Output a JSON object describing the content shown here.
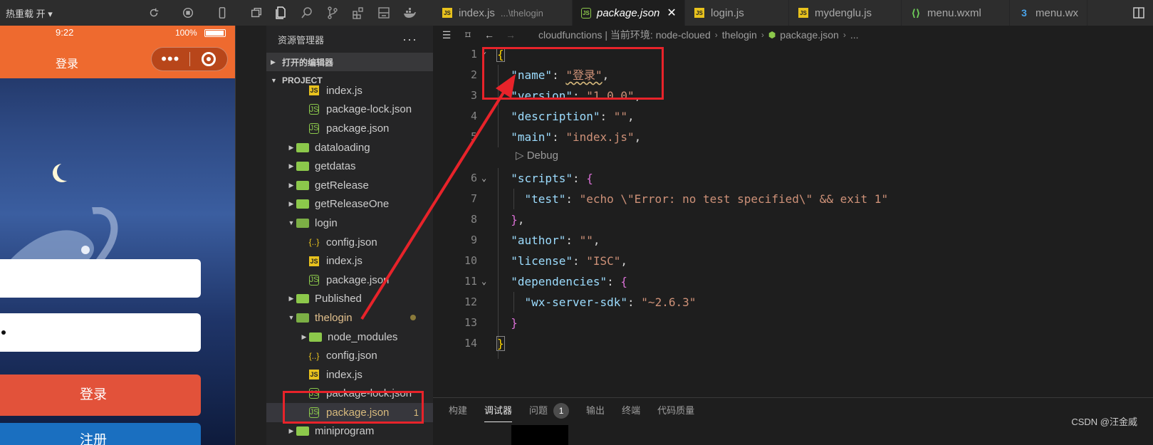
{
  "toolbar": {
    "hot_reload": "热重载 开 ▾"
  },
  "simulator": {
    "time": "9:22",
    "battery": "100%",
    "nav_title": "登录",
    "capsule_dots": "•••",
    "login_button": "登录",
    "register_button": "注册"
  },
  "explorer": {
    "title": "资源管理器",
    "more": "···",
    "open_editors": "打开的编辑器",
    "project": "PROJECT",
    "tree": [
      {
        "label": "index.js",
        "icon": "js",
        "depth": 2
      },
      {
        "label": "package-lock.json",
        "icon": "node",
        "depth": 2
      },
      {
        "label": "package.json",
        "icon": "node",
        "depth": 2
      },
      {
        "label": "dataloading",
        "icon": "folder",
        "depth": 1,
        "caret": "▶"
      },
      {
        "label": "getdatas",
        "icon": "folder",
        "depth": 1,
        "caret": "▶"
      },
      {
        "label": "getRelease",
        "icon": "folder",
        "depth": 1,
        "caret": "▶"
      },
      {
        "label": "getReleaseOne",
        "icon": "folder",
        "depth": 1,
        "caret": "▶"
      },
      {
        "label": "login",
        "icon": "folder-open",
        "depth": 1,
        "caret": "▼"
      },
      {
        "label": "config.json",
        "icon": "json",
        "depth": 2
      },
      {
        "label": "index.js",
        "icon": "js",
        "depth": 2
      },
      {
        "label": "package.json",
        "icon": "node",
        "depth": 2
      },
      {
        "label": "Published",
        "icon": "folder",
        "depth": 1,
        "caret": "▶"
      },
      {
        "label": "thelogin",
        "icon": "folder-open",
        "depth": 1,
        "caret": "▼",
        "modified": true
      },
      {
        "label": "node_modules",
        "icon": "folder",
        "depth": 2,
        "caret": "▶"
      },
      {
        "label": "config.json",
        "icon": "json",
        "depth": 2
      },
      {
        "label": "index.js",
        "icon": "js",
        "depth": 2
      },
      {
        "label": "package-lock.json",
        "icon": "node",
        "depth": 2
      },
      {
        "label": "package.json",
        "icon": "node",
        "depth": 2,
        "selected": true,
        "badge": "1"
      },
      {
        "label": "miniprogram",
        "icon": "folder",
        "depth": 1,
        "caret": "▶"
      }
    ]
  },
  "tabs": [
    {
      "label": "index.js",
      "desc": "...\\thelogin",
      "icon": "js"
    },
    {
      "label": "package.json",
      "icon": "node",
      "active": true,
      "close": "✕"
    },
    {
      "label": "login.js",
      "icon": "js"
    },
    {
      "label": "mydenglu.js",
      "icon": "js"
    },
    {
      "label": "menu.wxml",
      "icon": "wxml"
    },
    {
      "label": "menu.wx",
      "icon": "css"
    }
  ],
  "breadcrumb": {
    "env": "cloudfunctions | 当前环境: node-cloued",
    "folder": "thelogin",
    "file": "package.json",
    "tail": "..."
  },
  "editor": {
    "line_numbers": [
      "1",
      "2",
      "3",
      "4",
      "5",
      "6",
      "7",
      "8",
      "9",
      "10",
      "11",
      "12",
      "13",
      "14"
    ],
    "code_lens": "Debug",
    "name_key": "\"name\"",
    "name_value": "\"登录\"",
    "version_key": "\"version\"",
    "version_value": "\"1.0.0\"",
    "description_key": "\"description\"",
    "description_value": "\"\"",
    "main_key": "\"main\"",
    "main_value": "\"index.js\"",
    "scripts_key": "\"scripts\"",
    "test_key": "\"test\"",
    "test_value": "\"echo \\\"Error: no test specified\\\" && exit 1\"",
    "author_key": "\"author\"",
    "author_value": "\"\"",
    "license_key": "\"license\"",
    "license_value": "\"ISC\"",
    "dependencies_key": "\"dependencies\"",
    "sdk_key": "\"wx-server-sdk\"",
    "sdk_value": "\"~2.6.3\""
  },
  "panel": {
    "tabs": [
      "构建",
      "调试器",
      "问题",
      "输出",
      "终端",
      "代码质量"
    ],
    "problem_count": "1",
    "watermark": "CSDN @汪金威"
  },
  "colors": {
    "accent_orange": "#ee6a2f",
    "annotation_red": "#e8232a",
    "editor_bg": "#1e1e1e"
  }
}
